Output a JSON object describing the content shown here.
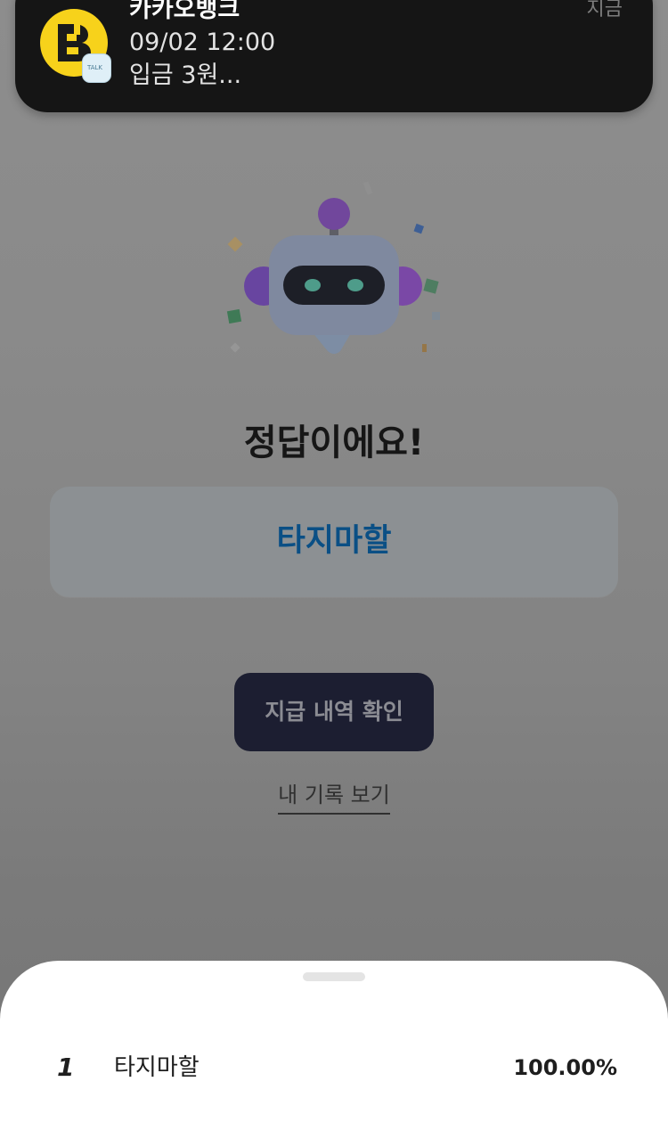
{
  "notification": {
    "app_name": "카카오뱅크",
    "time": "지금",
    "line1": "09/02 12:00",
    "line2": "입금 3원...",
    "badge_text": "TALK",
    "app_icon": "kakaobank-b-icon",
    "badge_icon": "kakaotalk-icon",
    "colors": {
      "banner": "#151515",
      "icon_yellow": "#f7d21b"
    }
  },
  "result": {
    "illustration": "robot-celebration-icon",
    "title": "정답이에요!",
    "answer": "타지마할"
  },
  "actions": {
    "payout_label": "지급 내역 확인",
    "records_label": "내 기록 보기"
  },
  "sheet": {
    "rank": "1",
    "word": "타지마할",
    "score": "100.00%"
  },
  "colors": {
    "accent_blue": "#0a4f85",
    "button_dark": "#1c1e31"
  }
}
